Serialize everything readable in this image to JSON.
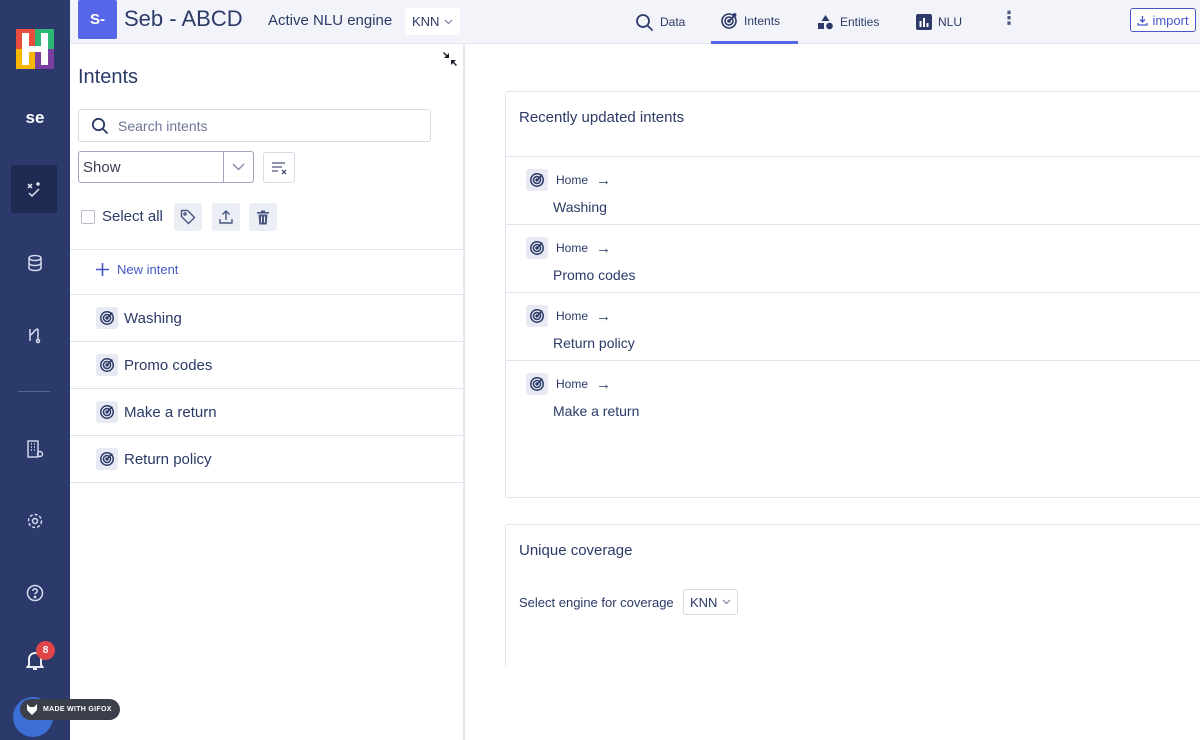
{
  "rail": {
    "project_short": "se",
    "notification_count": "8"
  },
  "topbar": {
    "project_badge": "S-",
    "project_name": "Seb - ABCD",
    "engine_label": "Active NLU engine",
    "engine_value": "KNN",
    "tabs": [
      {
        "label": "Data",
        "icon": "search-icon"
      },
      {
        "label": "Intents",
        "icon": "target-icon",
        "active": true
      },
      {
        "label": "Entities",
        "icon": "shapes-icon"
      },
      {
        "label": "NLU",
        "icon": "bar-chart-icon"
      }
    ],
    "import_label": "import"
  },
  "panel": {
    "title": "Intents",
    "search_placeholder": "Search intents",
    "show_select": "Show",
    "select_all_label": "Select all",
    "new_intent_label": "New intent",
    "intents": [
      "Washing",
      "Promo codes",
      "Make a return",
      "Return policy"
    ]
  },
  "recent": {
    "title": "Recently updated intents",
    "items": [
      {
        "crumb": "Home",
        "arrow": "→",
        "name": "Washing"
      },
      {
        "crumb": "Home",
        "arrow": "→",
        "name": "Promo codes"
      },
      {
        "crumb": "Home",
        "arrow": "→",
        "name": "Return policy"
      },
      {
        "crumb": "Home",
        "arrow": "→",
        "name": "Make a return"
      }
    ]
  },
  "coverage": {
    "title": "Unique coverage",
    "select_label": "Select engine for coverage",
    "engine_value": "KNN"
  },
  "watermark": "MADE WITH GIFOX",
  "colors": {
    "rail": "#2c3a6b",
    "accent": "#5566e8",
    "text": "#2b3a67",
    "badge": "#e0454a"
  }
}
